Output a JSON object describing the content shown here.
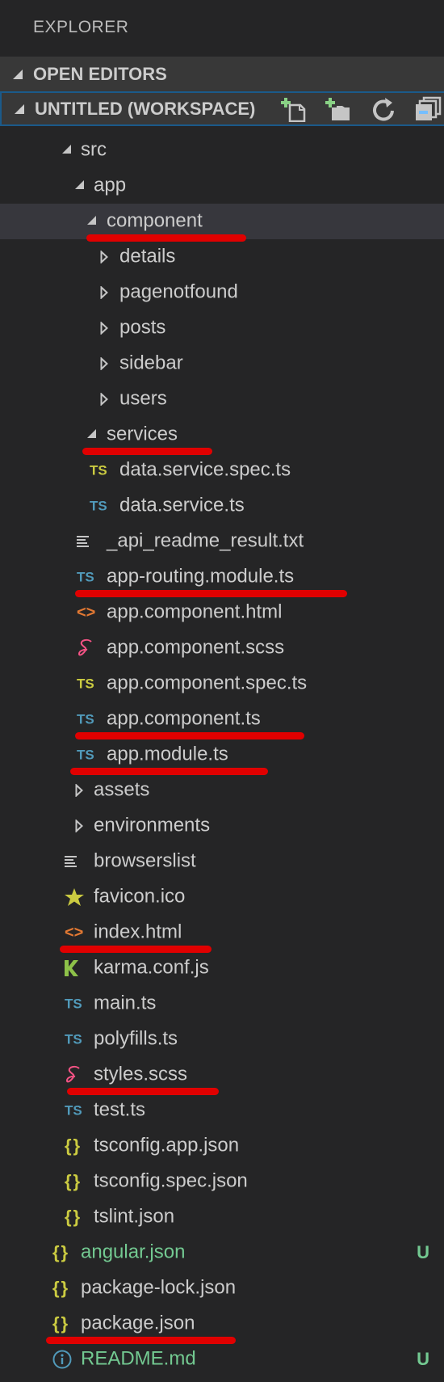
{
  "explorer": {
    "title": "EXPLORER"
  },
  "sections": {
    "open_editors": {
      "label": "OPEN EDITORS"
    },
    "workspace": {
      "label": "UNTITLED (WORKSPACE)",
      "actions": [
        {
          "name": "new-file",
          "icon": "new-file-icon"
        },
        {
          "name": "new-folder",
          "icon": "new-folder-icon"
        },
        {
          "name": "refresh",
          "icon": "refresh-icon"
        },
        {
          "name": "collapse-all",
          "icon": "collapse-all-icon"
        }
      ]
    }
  },
  "tree": [
    {
      "name": "src",
      "type": "folder",
      "expanded": true,
      "depth": 0
    },
    {
      "name": "app",
      "type": "folder",
      "expanded": true,
      "depth": 1
    },
    {
      "name": "component",
      "type": "folder",
      "expanded": true,
      "depth": 2,
      "selected": true,
      "annotated": true
    },
    {
      "name": "details",
      "type": "folder",
      "expanded": false,
      "depth": 3
    },
    {
      "name": "pagenotfound",
      "type": "folder",
      "expanded": false,
      "depth": 3
    },
    {
      "name": "posts",
      "type": "folder",
      "expanded": false,
      "depth": 3
    },
    {
      "name": "sidebar",
      "type": "folder",
      "expanded": false,
      "depth": 3
    },
    {
      "name": "users",
      "type": "folder",
      "expanded": false,
      "depth": 3
    },
    {
      "name": "services",
      "type": "folder",
      "expanded": true,
      "depth": 2,
      "annotated": true
    },
    {
      "name": "data.service.spec.ts",
      "type": "file",
      "icon": "ts-spec-icon",
      "icon_text": "TS",
      "depth": 3
    },
    {
      "name": "data.service.ts",
      "type": "file",
      "icon": "ts-icon",
      "icon_text": "TS",
      "depth": 3
    },
    {
      "name": "_api_readme_result.txt",
      "type": "file",
      "icon": "text-file-icon",
      "depth": 2
    },
    {
      "name": "app-routing.module.ts",
      "type": "file",
      "icon": "ts-icon",
      "icon_text": "TS",
      "depth": 2,
      "annotated": true
    },
    {
      "name": "app.component.html",
      "type": "file",
      "icon": "html-icon",
      "icon_text": "<>",
      "depth": 2
    },
    {
      "name": "app.component.scss",
      "type": "file",
      "icon": "sass-icon",
      "depth": 2
    },
    {
      "name": "app.component.spec.ts",
      "type": "file",
      "icon": "ts-spec-icon",
      "icon_text": "TS",
      "depth": 2
    },
    {
      "name": "app.component.ts",
      "type": "file",
      "icon": "ts-icon",
      "icon_text": "TS",
      "depth": 2,
      "annotated": true
    },
    {
      "name": "app.module.ts",
      "type": "file",
      "icon": "ts-icon",
      "icon_text": "TS",
      "depth": 2,
      "annotated": true
    },
    {
      "name": "assets",
      "type": "folder",
      "expanded": false,
      "depth": 1
    },
    {
      "name": "environments",
      "type": "folder",
      "expanded": false,
      "depth": 1
    },
    {
      "name": "browserslist",
      "type": "file",
      "icon": "text-file-icon",
      "depth": 1
    },
    {
      "name": "favicon.ico",
      "type": "file",
      "icon": "star-icon",
      "depth": 1
    },
    {
      "name": "index.html",
      "type": "file",
      "icon": "html-icon",
      "icon_text": "<>",
      "depth": 1,
      "annotated": true
    },
    {
      "name": "karma.conf.js",
      "type": "file",
      "icon": "karma-icon",
      "depth": 1
    },
    {
      "name": "main.ts",
      "type": "file",
      "icon": "ts-icon",
      "icon_text": "TS",
      "depth": 1
    },
    {
      "name": "polyfills.ts",
      "type": "file",
      "icon": "ts-icon",
      "icon_text": "TS",
      "depth": 1
    },
    {
      "name": "styles.scss",
      "type": "file",
      "icon": "sass-icon",
      "depth": 1,
      "annotated": true
    },
    {
      "name": "test.ts",
      "type": "file",
      "icon": "ts-icon",
      "icon_text": "TS",
      "depth": 1
    },
    {
      "name": "tsconfig.app.json",
      "type": "file",
      "icon": "json-icon",
      "icon_text": "{ }",
      "depth": 1
    },
    {
      "name": "tsconfig.spec.json",
      "type": "file",
      "icon": "json-icon",
      "icon_text": "{ }",
      "depth": 1
    },
    {
      "name": "tslint.json",
      "type": "file",
      "icon": "json-icon",
      "icon_text": "{ }",
      "depth": 1
    },
    {
      "name": "angular.json",
      "type": "file",
      "icon": "json-icon",
      "icon_text": "{ }",
      "depth": 0,
      "git_status": "U"
    },
    {
      "name": "package-lock.json",
      "type": "file",
      "icon": "json-icon",
      "icon_text": "{ }",
      "depth": 0
    },
    {
      "name": "package.json",
      "type": "file",
      "icon": "json-icon",
      "icon_text": "{ }",
      "depth": 0,
      "annotated": true
    },
    {
      "name": "README.md",
      "type": "file",
      "icon": "info-icon",
      "depth": 0,
      "git_status": "U"
    }
  ],
  "colors": {
    "background": "#252526",
    "section_header": "#383838",
    "selected_row": "#37373d",
    "focus_border": "#1b5a8a",
    "untracked": "#73c991",
    "ts_blue": "#519aba",
    "ts_spec_yellow": "#cbcb41",
    "html_orange": "#e37933",
    "sass_pink": "#f55385",
    "karma_green": "#8dc149",
    "annotation_red": "#e00000"
  }
}
